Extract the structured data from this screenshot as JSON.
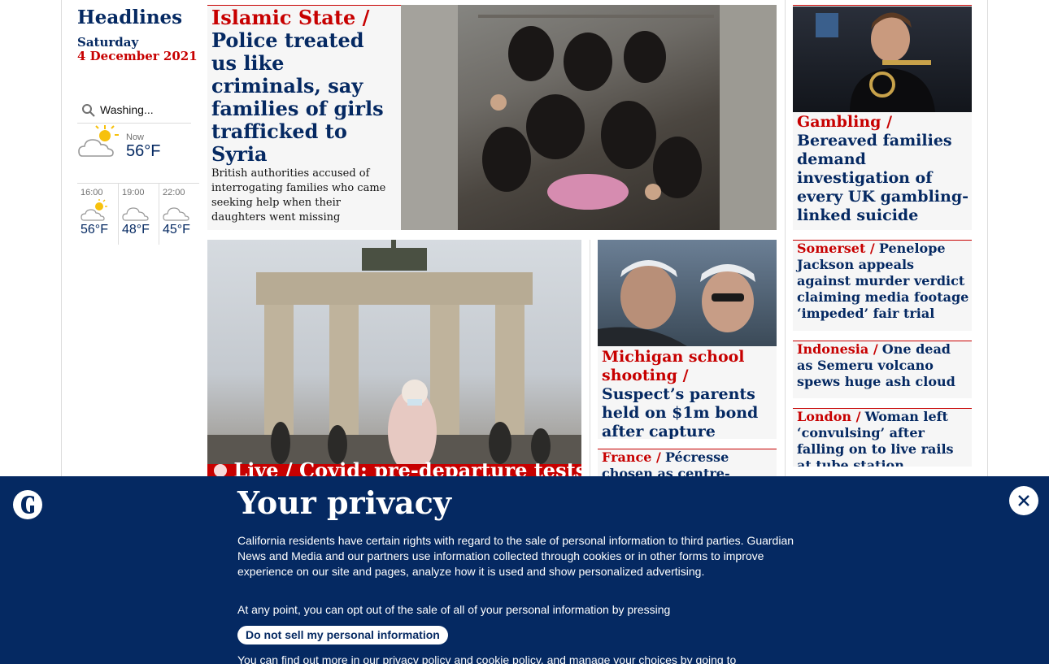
{
  "sidebar": {
    "title": "Headlines",
    "day": "Saturday",
    "date": "4 December 2021",
    "search_placeholder": "Washing...",
    "weather": {
      "now_label": "Now",
      "now_temp": "56°F",
      "forecast": [
        {
          "time": "16:00",
          "temp": "56°F",
          "icon": "partly-cloudy-icon"
        },
        {
          "time": "19:00",
          "temp": "48°F",
          "icon": "cloudy-night-icon"
        },
        {
          "time": "22:00",
          "temp": "45°F",
          "icon": "cloudy-night-icon"
        }
      ]
    }
  },
  "stories": {
    "main": {
      "kicker": "Islamic State /",
      "headline": "Police treated us like criminals, say families of girls trafficked to Syria",
      "standfirst": "British authorities accused of interrogating families who came seeking help when their daughters went missing"
    },
    "gambling": {
      "kicker": "Gambling /",
      "headline": "Bereaved families demand investigation of every UK gambling-linked suicide"
    },
    "covid": {
      "live": "Live /",
      "kicker": "Covid:",
      "headline": "pre-departure tests return"
    },
    "michigan": {
      "kicker": "Michigan school shooting /",
      "headline": "Suspect’s parents held on $1m bond after capture"
    },
    "france": {
      "kicker": "France /",
      "headline": "Pécresse chosen as centre-right’s first"
    },
    "somerset": {
      "kicker": "Somerset /",
      "headline": "Penelope Jackson appeals against murder verdict claiming media footage ‘impeded’ fair trial"
    },
    "indonesia": {
      "kicker": "Indonesia /",
      "headline": "One dead as Semeru volcano spews huge ash cloud"
    },
    "london": {
      "kicker": "London /",
      "headline": "Woman left ‘convulsing’ after falling on to live rails at tube station"
    }
  },
  "privacy": {
    "title": "Your privacy",
    "body": "California residents have certain rights with regard to the sale of personal information to third parties. Guardian News and Media and our partners use information collected through cookies or in other forms to improve experience on our site and pages, analyze how it is used and show personalized advertising.",
    "body2": "At any point, you can opt out of the sale of all of your personal information by pressing",
    "button": "Do not sell my personal information",
    "body3_a": "You can find out more in our ",
    "body3_link1": "privacy policy",
    "body3_b": " and ",
    "body3_link2": "cookie policy",
    "body3_c": ", and manage your choices by going to"
  },
  "colors": {
    "brand": "#052962",
    "accent": "#c70000"
  }
}
